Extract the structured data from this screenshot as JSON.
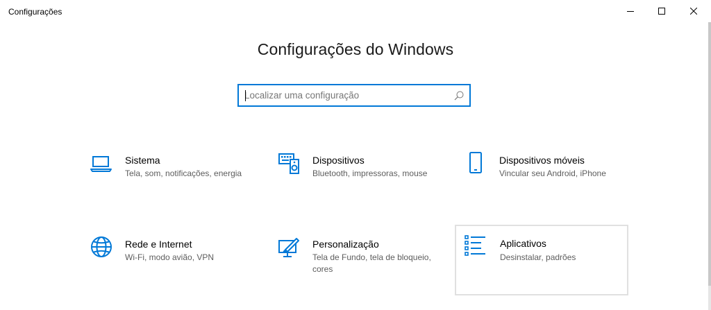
{
  "window": {
    "title": "Configurações",
    "controls": [
      "minimize-icon",
      "maximize-icon",
      "close-icon"
    ]
  },
  "page": {
    "title": "Configurações do Windows"
  },
  "search": {
    "placeholder": "Localizar uma configuração",
    "icon": "search-icon"
  },
  "categories": [
    {
      "title": "Sistema",
      "description": "Tela, som, notificações, energia",
      "icon": "laptop-icon"
    },
    {
      "title": "Dispositivos",
      "description": "Bluetooth, impressoras, mouse",
      "icon": "devices-icon"
    },
    {
      "title": "Dispositivos móveis",
      "description": "Vincular seu Android, iPhone",
      "icon": "phone-icon"
    },
    {
      "title": "Rede e Internet",
      "description": "Wi-Fi, modo avião, VPN",
      "icon": "globe-icon"
    },
    {
      "title": "Personalização",
      "description": "Tela de Fundo, tela de bloqueio, cores",
      "icon": "paintbrush-icon"
    },
    {
      "title": "Aplicativos",
      "description": "Desinstalar, padrões",
      "icon": "apps-list-icon"
    }
  ],
  "colors": {
    "accent": "#0078d7",
    "text": "#000000",
    "subtext": "#5d5d5d",
    "hover_border": "#e0e0e0"
  }
}
